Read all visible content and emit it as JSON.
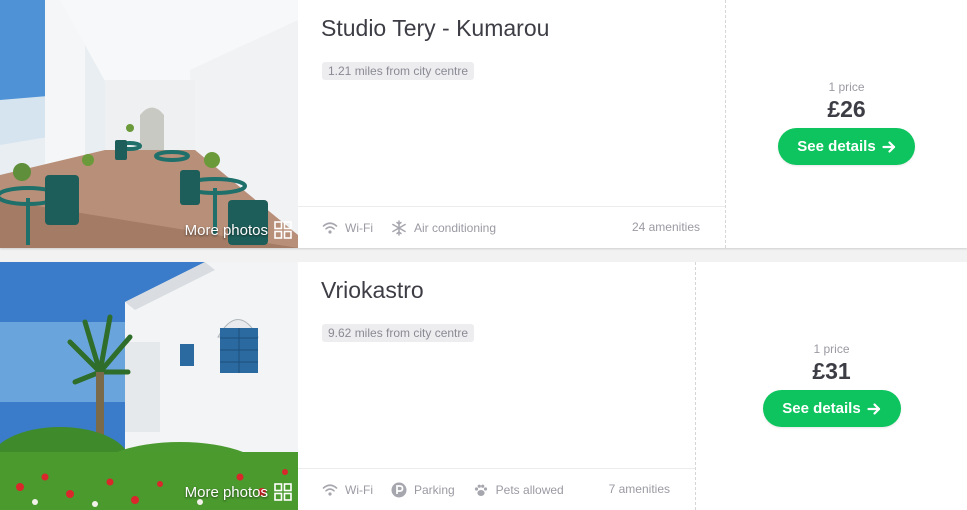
{
  "listings": [
    {
      "name": "Studio Tery - Kumarou",
      "distance": "1.21 miles from city centre",
      "more_photos": "More photos",
      "amenities": [
        {
          "label": "Wi-Fi",
          "icon": "wifi-icon"
        },
        {
          "label": "Air conditioning",
          "icon": "snowflake-icon"
        }
      ],
      "amenity_count": "24 amenities",
      "price_caption": "1 price",
      "price": "£26",
      "cta": "See details"
    },
    {
      "name": "Vriokastro",
      "distance": "9.62 miles from city centre",
      "more_photos": "More photos",
      "amenities": [
        {
          "label": "Wi-Fi",
          "icon": "wifi-icon"
        },
        {
          "label": "Parking",
          "icon": "parking-icon"
        },
        {
          "label": "Pets allowed",
          "icon": "paw-icon"
        }
      ],
      "amenity_count": "7 amenities",
      "price_caption": "1 price",
      "price": "£31",
      "cta": "See details"
    }
  ],
  "colors": {
    "cta_green": "#0dc45f",
    "badge_bg": "#ededf0",
    "muted_text": "#9a9aa3"
  }
}
